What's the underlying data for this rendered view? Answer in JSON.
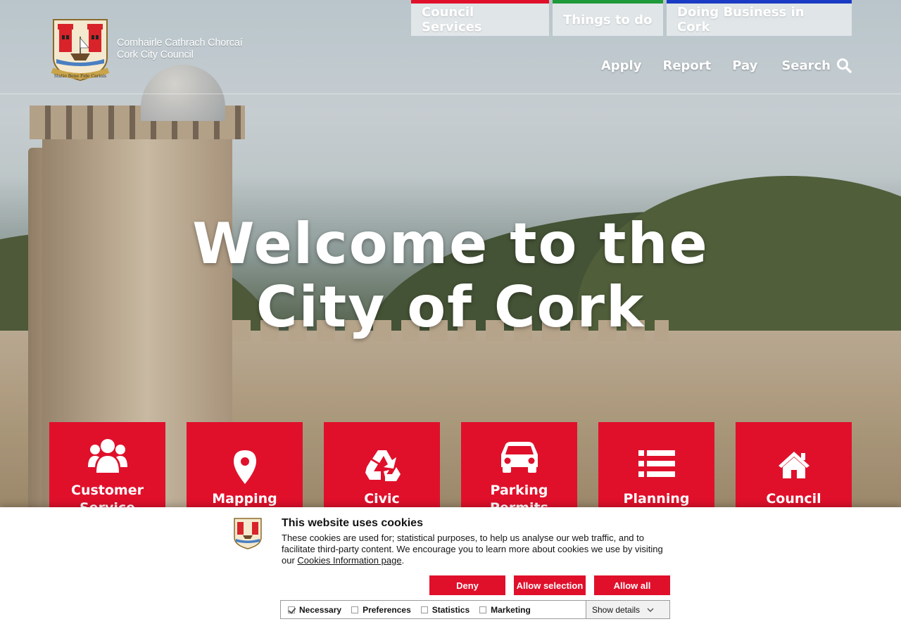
{
  "site": {
    "org_line1": "Comhairle Cathrach Chorcaí",
    "org_line2": "Cork City Council",
    "crest_motto": "Statio Bene Fide Carinis"
  },
  "top_tabs": [
    {
      "label": "Council Services",
      "accent": "#e0102b"
    },
    {
      "label": "Things to do",
      "accent": "#1f9a3b"
    },
    {
      "label": "Doing Business in Cork",
      "accent": "#1a3cc4"
    }
  ],
  "sub_nav": {
    "apply": "Apply",
    "report": "Report",
    "pay": "Pay",
    "search": "Search",
    "search_icon": "search-icon"
  },
  "hero": {
    "line1": "Welcome to the",
    "line2": "City of Cork"
  },
  "tiles": [
    {
      "line1": "Customer",
      "line2": "Service",
      "icon": "users-icon"
    },
    {
      "line1": "Mapping",
      "line2": "",
      "icon": "map-marker-icon"
    },
    {
      "line1": "Civic",
      "line2": "",
      "icon": "recycle-icon"
    },
    {
      "line1": "Parking",
      "line2": "Permits",
      "icon": "car-icon"
    },
    {
      "line1": "Planning",
      "line2": "",
      "icon": "list-icon"
    },
    {
      "line1": "Council",
      "line2": "",
      "icon": "home-icon"
    }
  ],
  "cookie": {
    "title": "This website uses cookies",
    "text": "These cookies are used for; statistical purposes, to help us analyse our web traffic, and to facilitate third-party content. We encourage you to learn more about cookies we use by visiting our ",
    "link": "Cookies Information page",
    "text_end": ".",
    "deny": "Deny",
    "allow_selection": "Allow selection",
    "allow_all": "Allow all",
    "options": [
      {
        "label": "Necessary",
        "checked": true
      },
      {
        "label": "Preferences",
        "checked": false
      },
      {
        "label": "Statistics",
        "checked": false
      },
      {
        "label": "Marketing",
        "checked": false
      }
    ],
    "show_details": "Show details"
  },
  "colors": {
    "brand_red": "#e0102b",
    "green": "#1f9a3b",
    "blue": "#1a3cc4"
  }
}
